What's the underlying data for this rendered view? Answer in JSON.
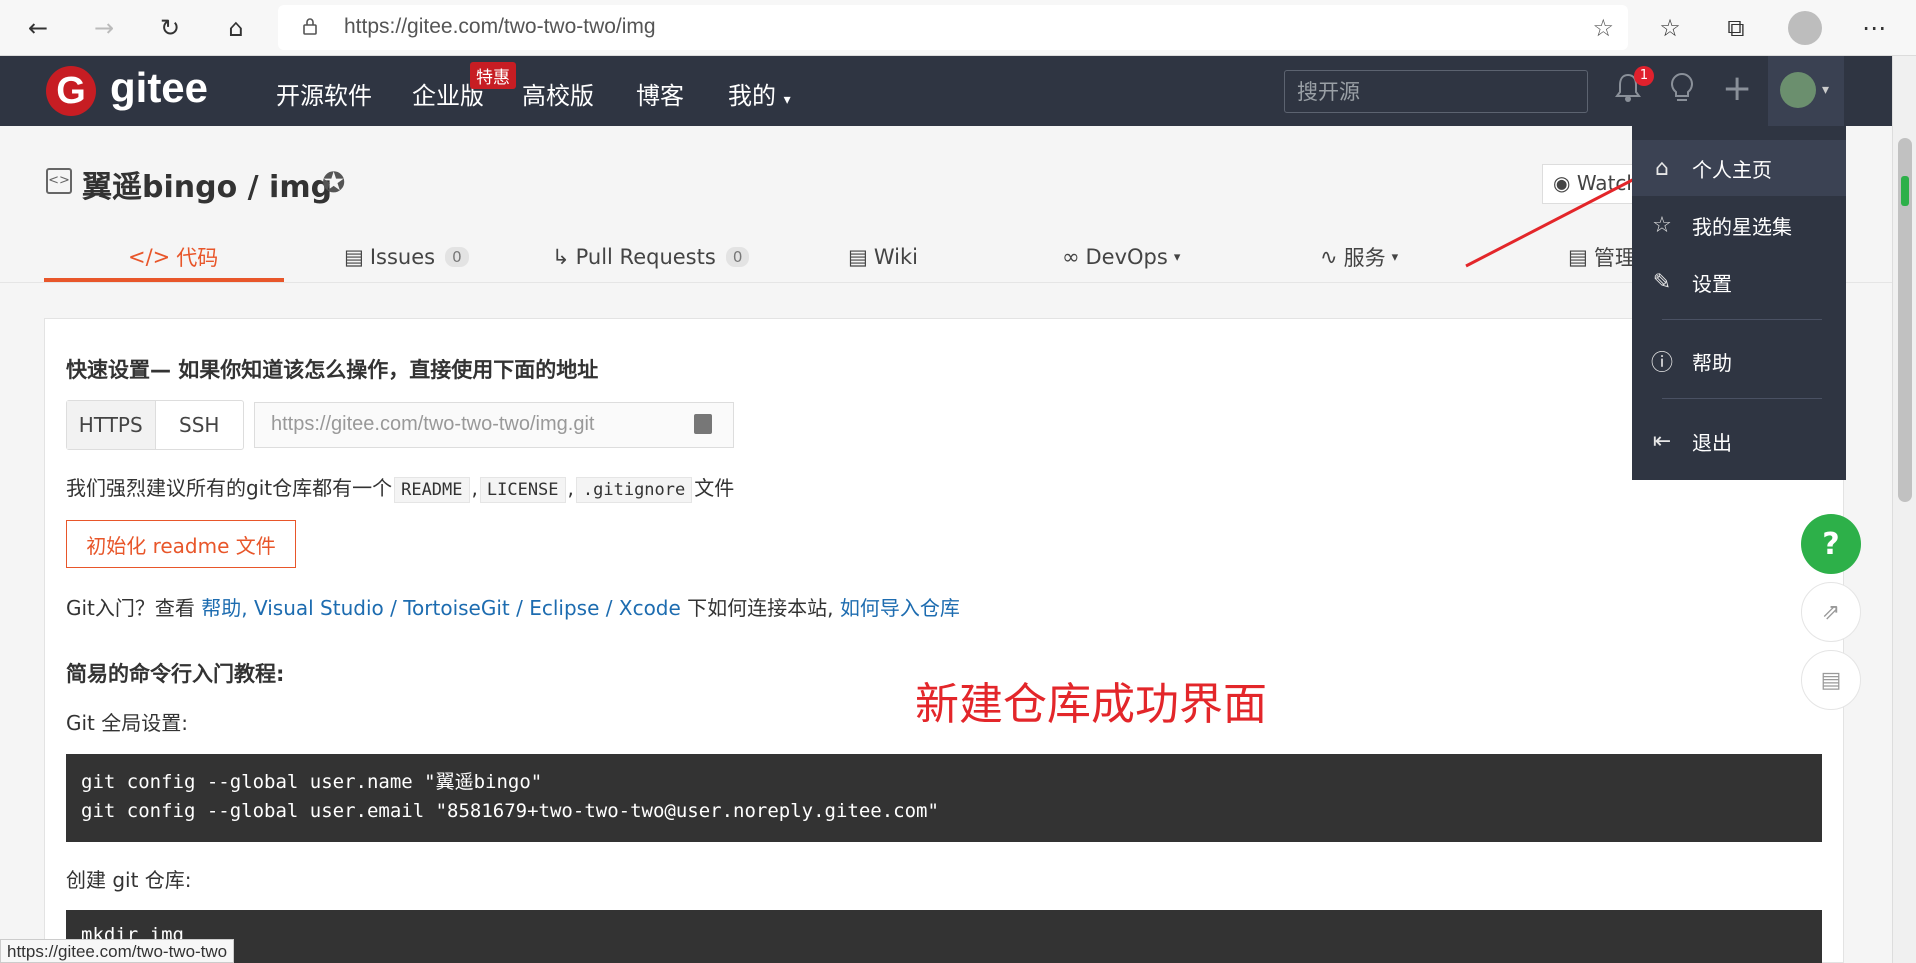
{
  "browser": {
    "url": "https://gitee.com/two-two-two/img"
  },
  "header": {
    "logo_letter": "G",
    "logo_text": "gitee",
    "nav": {
      "open_source": "开源软件",
      "enterprise": "企业版",
      "special_badge": "特惠",
      "university": "高校版",
      "blog": "博客",
      "mine": "我的"
    },
    "search_placeholder": "搜开源",
    "notification_count": "1"
  },
  "repo": {
    "title": "翼遥bingo / img",
    "watch_label": "Watch",
    "tabs": {
      "code": "代码",
      "issues": "Issues",
      "issues_count": "0",
      "pull_requests": "Pull Requests",
      "pr_count": "0",
      "wiki": "Wiki",
      "devops": "DevOps",
      "services": "服务",
      "manage": "管理"
    }
  },
  "quick_setup": {
    "title": "快速设置— 如果你知道该怎么操作，直接使用下面的地址",
    "https_label": "HTTPS",
    "ssh_label": "SSH",
    "clone_url": "https://gitee.com/two-two-two/img.git",
    "recommend_prefix": "我们强烈建议所有的git仓库都有一个",
    "readme_chip": "README",
    "license_chip": "LICENSE",
    "gitignore_chip": ".gitignore",
    "recommend_suffix": "文件",
    "comma": ",",
    "init_readme_button": "初始化 readme 文件",
    "git_intro_prefix": "Git入门？查看",
    "link_help": "帮助",
    "link_vs": "Visual Studio",
    "link_tortoise": "TortoiseGit",
    "link_eclipse": "Eclipse",
    "link_xcode": "Xcode",
    "slash": "/",
    "git_intro_mid": "下如何连接本站,",
    "link_import": "如何导入仓库"
  },
  "tutorial": {
    "title": "简易的命令行入门教程:",
    "global_label": "Git 全局设置:",
    "global_line1": "git config --global user.name \"翼遥bingo\"",
    "global_line2": "git config --global user.email \"8581679+two-two-two@user.noreply.gitee.com\"",
    "create_label": "创建 git 仓库:",
    "create_line1": "mkdir img"
  },
  "annotation_text": "新建仓库成功界面",
  "dropdown": {
    "items": [
      {
        "label": "个人主页",
        "icon": "home-icon"
      },
      {
        "label": "我的星选集",
        "icon": "star-icon"
      },
      {
        "label": "设置",
        "icon": "edit-icon"
      },
      {
        "label": "帮助",
        "icon": "help-icon"
      },
      {
        "label": "退出",
        "icon": "logout-icon"
      }
    ]
  },
  "float": {
    "help": "?"
  },
  "status_bar_url": "https://gitee.com/two-two-two",
  "colors": {
    "brand_red": "#c71d23",
    "accent_orange": "#e8562a",
    "header_bg": "#2f3542",
    "help_green": "#2db049",
    "link_blue": "#1d6cb0",
    "annotation_red": "#e3262a"
  }
}
